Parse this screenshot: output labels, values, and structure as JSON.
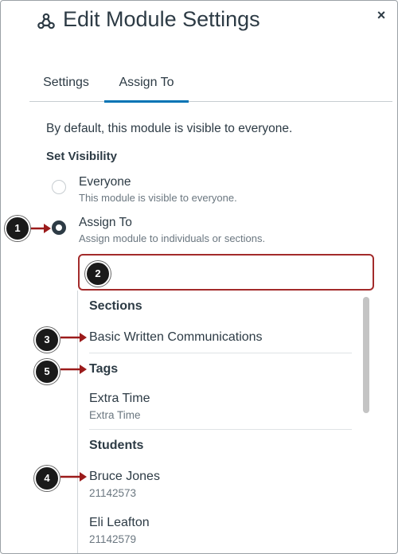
{
  "dialog": {
    "title": "Edit Module Settings",
    "close_label": "×"
  },
  "tabs": [
    {
      "label": "Settings",
      "selected": false
    },
    {
      "label": "Assign To",
      "selected": true
    }
  ],
  "content": {
    "default_note": "By default, this module is visible to everyone.",
    "set_visibility_label": "Set Visibility",
    "options": [
      {
        "title": "Everyone",
        "description": "This module is visible to everyone.",
        "selected": false
      },
      {
        "title": "Assign To",
        "description": "Assign module to individuals or sections.",
        "selected": true
      }
    ],
    "search": {
      "value": "",
      "placeholder": ""
    }
  },
  "dropdown": {
    "sections_header": "Sections",
    "section_item": "Basic Written Communications",
    "tags_header": "Tags",
    "tag_item": {
      "title": "Extra Time",
      "subtitle": "Extra Time"
    },
    "students_header": "Students",
    "students": [
      {
        "name": "Bruce Jones",
        "id": "21142573"
      },
      {
        "name": "Eli Leafton",
        "id": "21142579"
      }
    ]
  },
  "callouts": [
    "1",
    "2",
    "3",
    "4",
    "5"
  ],
  "colors": {
    "accent": "#0374b5",
    "highlight_border": "#a32b2b",
    "arrow": "#9b1b1b",
    "text": "#2d3b45",
    "muted": "#6b7780"
  }
}
